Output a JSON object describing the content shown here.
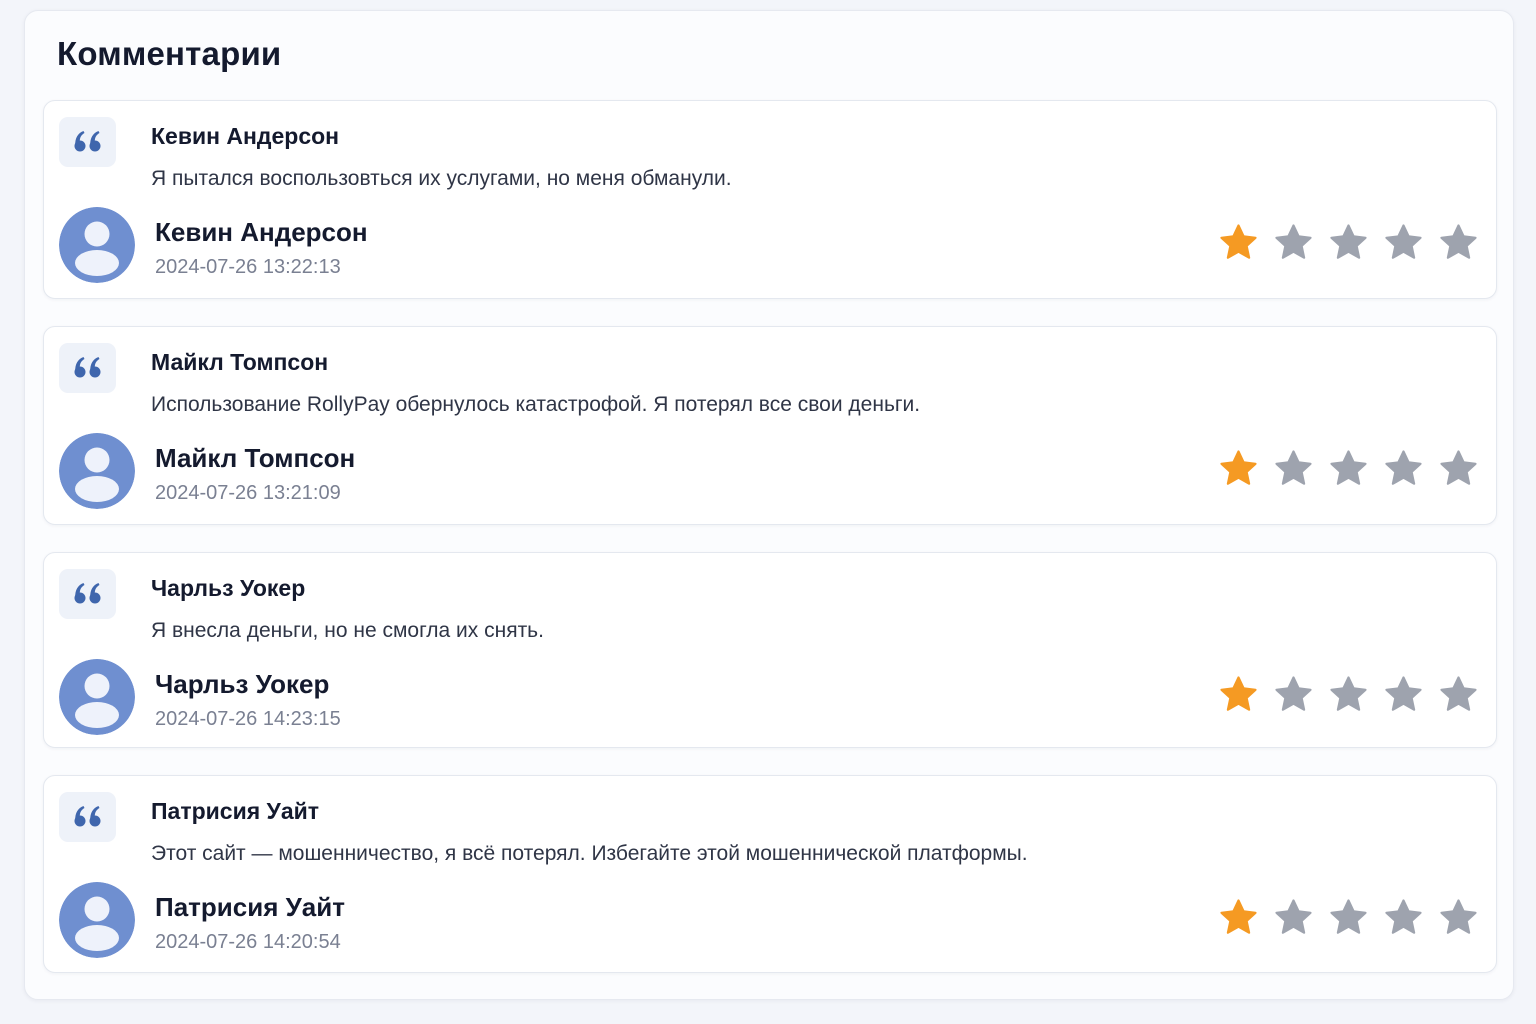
{
  "page": {
    "title": "Комментарии"
  },
  "colors": {
    "star_filled": "#f59a23",
    "star_empty": "#9ea3ae",
    "avatar": "#6f8fd0",
    "quote_mark": "#3f66ad"
  },
  "icons": {
    "quote": "quote-icon",
    "avatar": "user-avatar-icon",
    "star": "star-icon"
  },
  "reviews": [
    {
      "title": "Кевин Андерсон",
      "text": "Я пытался воспользовться их услугами, но меня обманули.",
      "author": "Кевин Андерсон",
      "date": "2024-07-26 13:22:13",
      "rating": 1,
      "max_rating": 5
    },
    {
      "title": "Майкл Томпсон",
      "text": "Использование RollyPay обернулось катастрофой. Я потерял все свои деньги.",
      "author": "Майкл Томпсон",
      "date": "2024-07-26 13:21:09",
      "rating": 1,
      "max_rating": 5
    },
    {
      "title": "Чарльз Уокер",
      "text": "Я внесла деньги, но не смогла их снять.",
      "author": "Чарльз Уокер",
      "date": "2024-07-26 14:23:15",
      "rating": 1,
      "max_rating": 5
    },
    {
      "title": "Патрисия Уайт",
      "text": "Этот сайт — мошенничество, я всё потерял. Избегайте этой мошеннической платформы.",
      "author": "Патрисия Уайт",
      "date": "2024-07-26 14:20:54",
      "rating": 1,
      "max_rating": 5
    }
  ]
}
